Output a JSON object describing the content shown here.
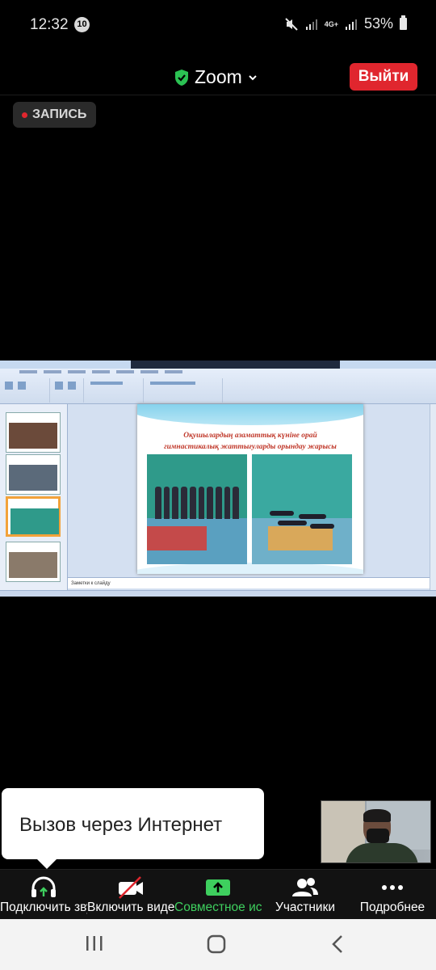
{
  "status_bar": {
    "time": "12:32",
    "notification_count": "10",
    "battery": "53%",
    "network": "4G+"
  },
  "header": {
    "app_title": "Zoom",
    "leave_label": "Выйти",
    "recording_label": "ЗАПИСЬ"
  },
  "shared_slide": {
    "title_line1": "Оқушылардың азаматтық күніне орай",
    "title_line2": "гимнастикалық жаттығуларды орындау жарысы",
    "notes_placeholder": "Заметки к слайду"
  },
  "tooltip": {
    "text": "Вызов через Интернет"
  },
  "toolbar": {
    "audio_label": "Подключить звук",
    "video_label": "Включить видео",
    "share_label": "Совместное использование",
    "participants_label": "Участники",
    "more_label": "Подробнее"
  },
  "colors": {
    "leave_button": "#e0262e",
    "share_accent": "#3ecf5e",
    "slide_title": "#c0392b"
  }
}
